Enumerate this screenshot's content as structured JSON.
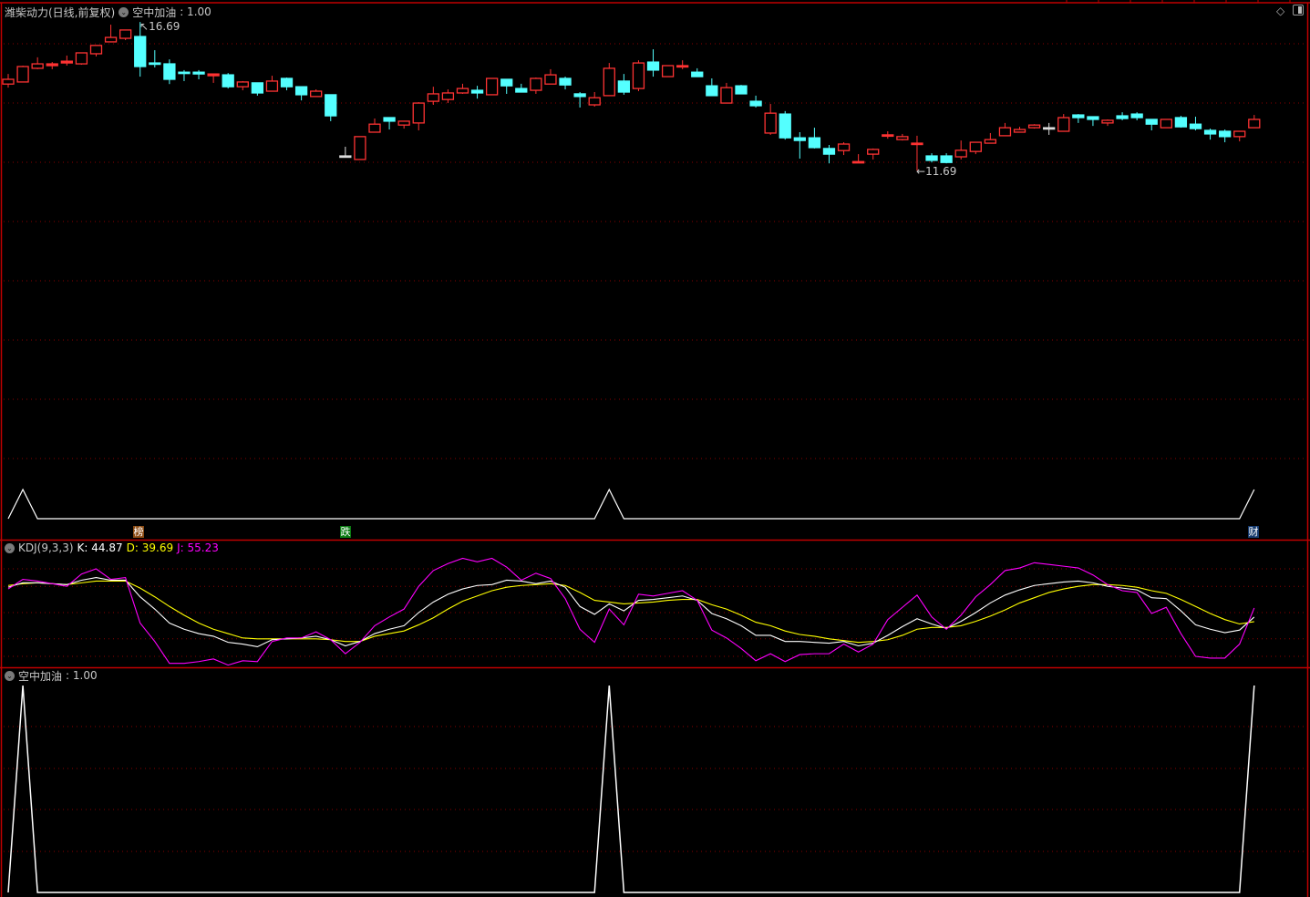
{
  "header": {
    "stock_title": "潍柴动力(日线,前复权)",
    "indicator_name": "空中加油",
    "indicator_value": ": 1.00"
  },
  "kdj_header": {
    "name": "KDJ(9,3,3)",
    "k_label": "K: 44.87",
    "d_label": "D: 39.69",
    "j_label": "J: 55.23"
  },
  "bottom_header": {
    "name": "空中加油",
    "value": ": 1.00"
  },
  "annotations": {
    "high_label": "16.69",
    "low_label": "11.69"
  },
  "markers": [
    {
      "label": "榜",
      "index": 9,
      "color": "#8a4a12"
    },
    {
      "label": "跌",
      "index": 23,
      "color": "#0b7a12"
    },
    {
      "label": "财",
      "index": 85,
      "color": "#153a6e"
    }
  ],
  "colors": {
    "up": "#ff3333",
    "down": "#54ffff",
    "flat": "#dddddd",
    "k": "#ffffff",
    "d": "#ffff00",
    "j": "#ff00ff",
    "grid": "#8b0000",
    "border": "#c00000"
  },
  "chart_data": {
    "type": "candlestick",
    "title": "潍柴动力(日线,前复权)",
    "ylim": [
      -0.74,
      17.43
    ],
    "candles_format": [
      "open",
      "high",
      "low",
      "close",
      "direction"
    ],
    "candles": [
      [
        14.6,
        14.94,
        14.48,
        14.76,
        "up"
      ],
      [
        14.67,
        15.22,
        14.67,
        15.19,
        "up"
      ],
      [
        15.13,
        15.5,
        15.1,
        15.28,
        "up"
      ],
      [
        15.22,
        15.34,
        15.1,
        15.28,
        "up"
      ],
      [
        15.31,
        15.56,
        15.22,
        15.37,
        "up"
      ],
      [
        15.28,
        15.65,
        15.25,
        15.65,
        "up"
      ],
      [
        15.62,
        15.9,
        15.53,
        15.9,
        "up"
      ],
      [
        16.02,
        16.6,
        16.02,
        16.17,
        "up"
      ],
      [
        16.14,
        16.42,
        16.08,
        16.42,
        "up"
      ],
      [
        16.2,
        16.69,
        14.85,
        15.19,
        "down"
      ],
      [
        15.31,
        15.74,
        15.16,
        15.31,
        "down"
      ],
      [
        15.28,
        15.43,
        14.6,
        14.76,
        "down"
      ],
      [
        15.0,
        15.07,
        14.7,
        15.0,
        "down"
      ],
      [
        15.0,
        15.07,
        14.76,
        14.94,
        "down"
      ],
      [
        14.88,
        14.94,
        14.64,
        14.94,
        "up"
      ],
      [
        14.91,
        14.97,
        14.45,
        14.51,
        "down"
      ],
      [
        14.51,
        14.7,
        14.39,
        14.67,
        "up"
      ],
      [
        14.64,
        14.64,
        14.21,
        14.3,
        "down"
      ],
      [
        14.36,
        14.88,
        14.36,
        14.7,
        "up"
      ],
      [
        14.79,
        14.82,
        14.39,
        14.51,
        "down"
      ],
      [
        14.51,
        14.51,
        14.05,
        14.24,
        "down"
      ],
      [
        14.18,
        14.42,
        14.18,
        14.36,
        "up"
      ],
      [
        14.24,
        14.24,
        13.35,
        13.53,
        "down"
      ],
      [
        12.18,
        12.49,
        12.18,
        12.18,
        "flat"
      ],
      [
        12.06,
        12.83,
        12.06,
        12.83,
        "up"
      ],
      [
        12.98,
        13.44,
        12.98,
        13.25,
        "up"
      ],
      [
        13.47,
        13.47,
        13.07,
        13.35,
        "down"
      ],
      [
        13.22,
        13.35,
        13.1,
        13.35,
        "up"
      ],
      [
        13.29,
        13.99,
        13.04,
        13.96,
        "up"
      ],
      [
        14.02,
        14.51,
        13.9,
        14.27,
        "up"
      ],
      [
        14.08,
        14.42,
        13.96,
        14.3,
        "up"
      ],
      [
        14.3,
        14.61,
        14.27,
        14.45,
        "up"
      ],
      [
        14.39,
        14.54,
        14.11,
        14.3,
        "down"
      ],
      [
        14.24,
        14.79,
        14.24,
        14.79,
        "up"
      ],
      [
        14.76,
        14.76,
        14.27,
        14.54,
        "down"
      ],
      [
        14.45,
        14.61,
        14.33,
        14.33,
        "down"
      ],
      [
        14.39,
        14.82,
        14.27,
        14.79,
        "up"
      ],
      [
        14.6,
        15.1,
        14.6,
        14.91,
        "up"
      ],
      [
        14.79,
        14.85,
        14.42,
        14.57,
        "down"
      ],
      [
        14.27,
        14.33,
        13.81,
        14.18,
        "down"
      ],
      [
        13.9,
        14.33,
        13.84,
        14.14,
        "up"
      ],
      [
        14.21,
        15.31,
        14.21,
        15.13,
        "up"
      ],
      [
        14.7,
        14.94,
        14.24,
        14.33,
        "down"
      ],
      [
        14.45,
        15.4,
        14.36,
        15.31,
        "up"
      ],
      [
        15.34,
        15.77,
        14.85,
        15.07,
        "down"
      ],
      [
        14.85,
        15.22,
        14.85,
        15.22,
        "up"
      ],
      [
        15.22,
        15.4,
        15.1,
        15.22,
        "up"
      ],
      [
        15.0,
        15.13,
        14.85,
        14.85,
        "down"
      ],
      [
        14.54,
        14.79,
        14.21,
        14.21,
        "down"
      ],
      [
        13.96,
        14.64,
        13.96,
        14.48,
        "up"
      ],
      [
        14.54,
        14.57,
        14.27,
        14.27,
        "down"
      ],
      [
        14.02,
        14.21,
        13.81,
        13.87,
        "down"
      ],
      [
        12.95,
        13.93,
        12.89,
        13.62,
        "up"
      ],
      [
        13.59,
        13.69,
        12.73,
        12.79,
        "down"
      ],
      [
        12.79,
        12.98,
        12.09,
        12.7,
        "down"
      ],
      [
        12.79,
        13.13,
        12.43,
        12.46,
        "down"
      ],
      [
        12.43,
        12.55,
        11.93,
        12.24,
        "down"
      ],
      [
        12.36,
        12.64,
        12.21,
        12.58,
        "up"
      ],
      [
        11.99,
        12.24,
        11.99,
        11.99,
        "up"
      ],
      [
        12.24,
        12.43,
        12.06,
        12.4,
        "up"
      ],
      [
        12.89,
        13.01,
        12.76,
        12.89,
        "up"
      ],
      [
        12.73,
        12.92,
        12.7,
        12.83,
        "up"
      ],
      [
        12.58,
        12.86,
        11.69,
        12.61,
        "up"
      ],
      [
        12.18,
        12.27,
        11.96,
        12.03,
        "down"
      ],
      [
        12.18,
        12.27,
        11.93,
        11.96,
        "down"
      ],
      [
        12.15,
        12.7,
        12.06,
        12.37,
        "up"
      ],
      [
        12.33,
        12.64,
        12.24,
        12.64,
        "up"
      ],
      [
        12.61,
        12.95,
        12.61,
        12.73,
        "up"
      ],
      [
        12.86,
        13.29,
        12.86,
        13.13,
        "up"
      ],
      [
        12.98,
        13.16,
        12.98,
        13.07,
        "up"
      ],
      [
        13.13,
        13.25,
        13.1,
        13.22,
        "up"
      ],
      [
        13.13,
        13.29,
        12.89,
        13.13,
        "flat"
      ],
      [
        13.01,
        13.59,
        13.01,
        13.47,
        "up"
      ],
      [
        13.56,
        13.59,
        13.29,
        13.47,
        "down"
      ],
      [
        13.5,
        13.5,
        13.19,
        13.41,
        "down"
      ],
      [
        13.29,
        13.41,
        13.19,
        13.38,
        "up"
      ],
      [
        13.53,
        13.65,
        13.38,
        13.44,
        "down"
      ],
      [
        13.59,
        13.65,
        13.38,
        13.47,
        "down"
      ],
      [
        13.41,
        13.41,
        13.04,
        13.25,
        "down"
      ],
      [
        13.13,
        13.41,
        13.13,
        13.41,
        "up"
      ],
      [
        13.47,
        13.53,
        13.13,
        13.16,
        "down"
      ],
      [
        13.25,
        13.5,
        13.04,
        13.1,
        "down"
      ],
      [
        13.04,
        13.1,
        12.73,
        12.92,
        "down"
      ],
      [
        13.01,
        13.07,
        12.64,
        12.83,
        "down"
      ],
      [
        12.83,
        13.01,
        12.67,
        13.01,
        "up"
      ],
      [
        13.13,
        13.56,
        13.13,
        13.41,
        "up"
      ]
    ],
    "high_marker": {
      "index": 9,
      "value": 16.69
    },
    "low_marker": {
      "index": 62,
      "value": 11.69
    },
    "signal": {
      "name": "空中加油",
      "ylim": [
        0,
        1
      ],
      "values": [
        0,
        1,
        0,
        0,
        0,
        0,
        0,
        0,
        0,
        0,
        0,
        0,
        0,
        0,
        0,
        0,
        0,
        0,
        0,
        0,
        0,
        0,
        0,
        0,
        0,
        0,
        0,
        0,
        0,
        0,
        0,
        0,
        0,
        0,
        0,
        0,
        0,
        0,
        0,
        0,
        0,
        1,
        0,
        0,
        0,
        0,
        0,
        0,
        0,
        0,
        0,
        0,
        0,
        0,
        0,
        0,
        0,
        0,
        0,
        0,
        0,
        0,
        0,
        0,
        0,
        0,
        0,
        0,
        0,
        0,
        0,
        0,
        0,
        0,
        0,
        0,
        0,
        0,
        0,
        0,
        0,
        0,
        0,
        0,
        0,
        1
      ]
    },
    "kdj": {
      "name": "KDJ(9,3,3)",
      "ylim": [
        -10,
        110
      ],
      "gridlines": [
        0,
        20,
        50,
        80,
        100
      ],
      "K": [
        79,
        84,
        84,
        83,
        82,
        87,
        90,
        87,
        87,
        68,
        54,
        38,
        31,
        26,
        23,
        16,
        14,
        11,
        19,
        20,
        21,
        23,
        19,
        12,
        17,
        26,
        31,
        35,
        50,
        62,
        71,
        77,
        81,
        82,
        87,
        86,
        83,
        86,
        79,
        57,
        48,
        60,
        52,
        64,
        65,
        67,
        69,
        64,
        49,
        43,
        35,
        24,
        24,
        17,
        17,
        16,
        15,
        17,
        12,
        15,
        24,
        34,
        43,
        37,
        32,
        40,
        50,
        61,
        70,
        76,
        81,
        83,
        85,
        86,
        84,
        80,
        78,
        76,
        67,
        66,
        52,
        36,
        31,
        27,
        30,
        44.87
      ],
      "D": [
        81,
        83,
        84,
        83,
        82,
        84,
        86,
        86,
        86,
        78,
        68,
        57,
        47,
        38,
        31,
        26,
        21,
        20,
        20,
        20,
        20,
        20,
        19,
        17,
        17,
        23,
        26,
        29,
        36,
        44,
        54,
        63,
        69,
        75,
        79,
        81,
        82,
        83,
        81,
        73,
        64,
        62,
        60,
        61,
        62,
        64,
        65,
        65,
        59,
        54,
        47,
        39,
        35,
        29,
        25,
        23,
        20,
        18,
        16,
        17,
        19,
        24,
        31,
        33,
        33,
        35,
        40,
        46,
        53,
        61,
        67,
        73,
        77,
        80,
        82,
        82,
        81,
        79,
        75,
        72,
        65,
        57,
        49,
        42,
        37,
        39.69
      ],
      "J": [
        77,
        88,
        86,
        83,
        80,
        94,
        100,
        88,
        90,
        38,
        17,
        -8,
        -8,
        -6,
        -3,
        -10,
        -5,
        -6,
        17,
        21,
        21,
        28,
        19,
        3,
        16,
        35,
        45,
        54,
        80,
        98,
        106,
        112,
        108,
        112,
        102,
        87,
        95,
        89,
        66,
        31,
        16,
        54,
        36,
        71,
        69,
        72,
        75,
        64,
        30,
        21,
        9,
        -5,
        3,
        -6,
        2,
        3,
        3,
        14,
        5,
        14,
        42,
        56,
        70,
        45,
        31,
        47,
        68,
        82,
        98,
        101,
        107,
        105,
        103,
        101,
        93,
        82,
        75,
        73,
        49,
        56,
        26,
        0,
        -2,
        -2,
        14,
        55.23
      ]
    }
  }
}
